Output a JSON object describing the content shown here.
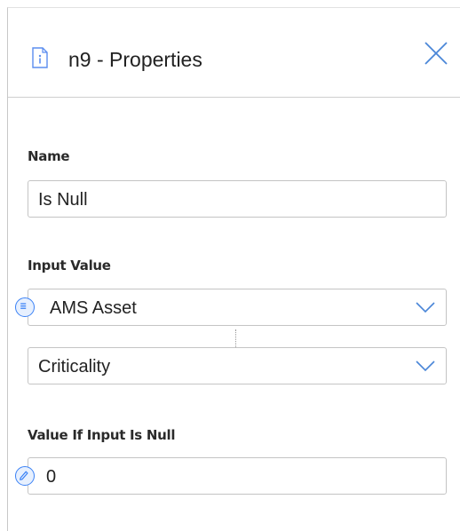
{
  "header": {
    "title": "n9 - Properties",
    "icon": "document-info-icon",
    "close_icon": "close-icon"
  },
  "name_section": {
    "label": "Name",
    "value": "Is Null"
  },
  "input_section": {
    "label": "Input Value",
    "source_icon": "list-icon",
    "source_value": "AMS Asset",
    "field_value": "Criticality"
  },
  "null_section": {
    "label": "Value If Input Is Null",
    "edit_icon": "pencil-icon",
    "value": "0"
  },
  "colors": {
    "accent": "#3b82f6",
    "border": "#c4c4c4"
  }
}
